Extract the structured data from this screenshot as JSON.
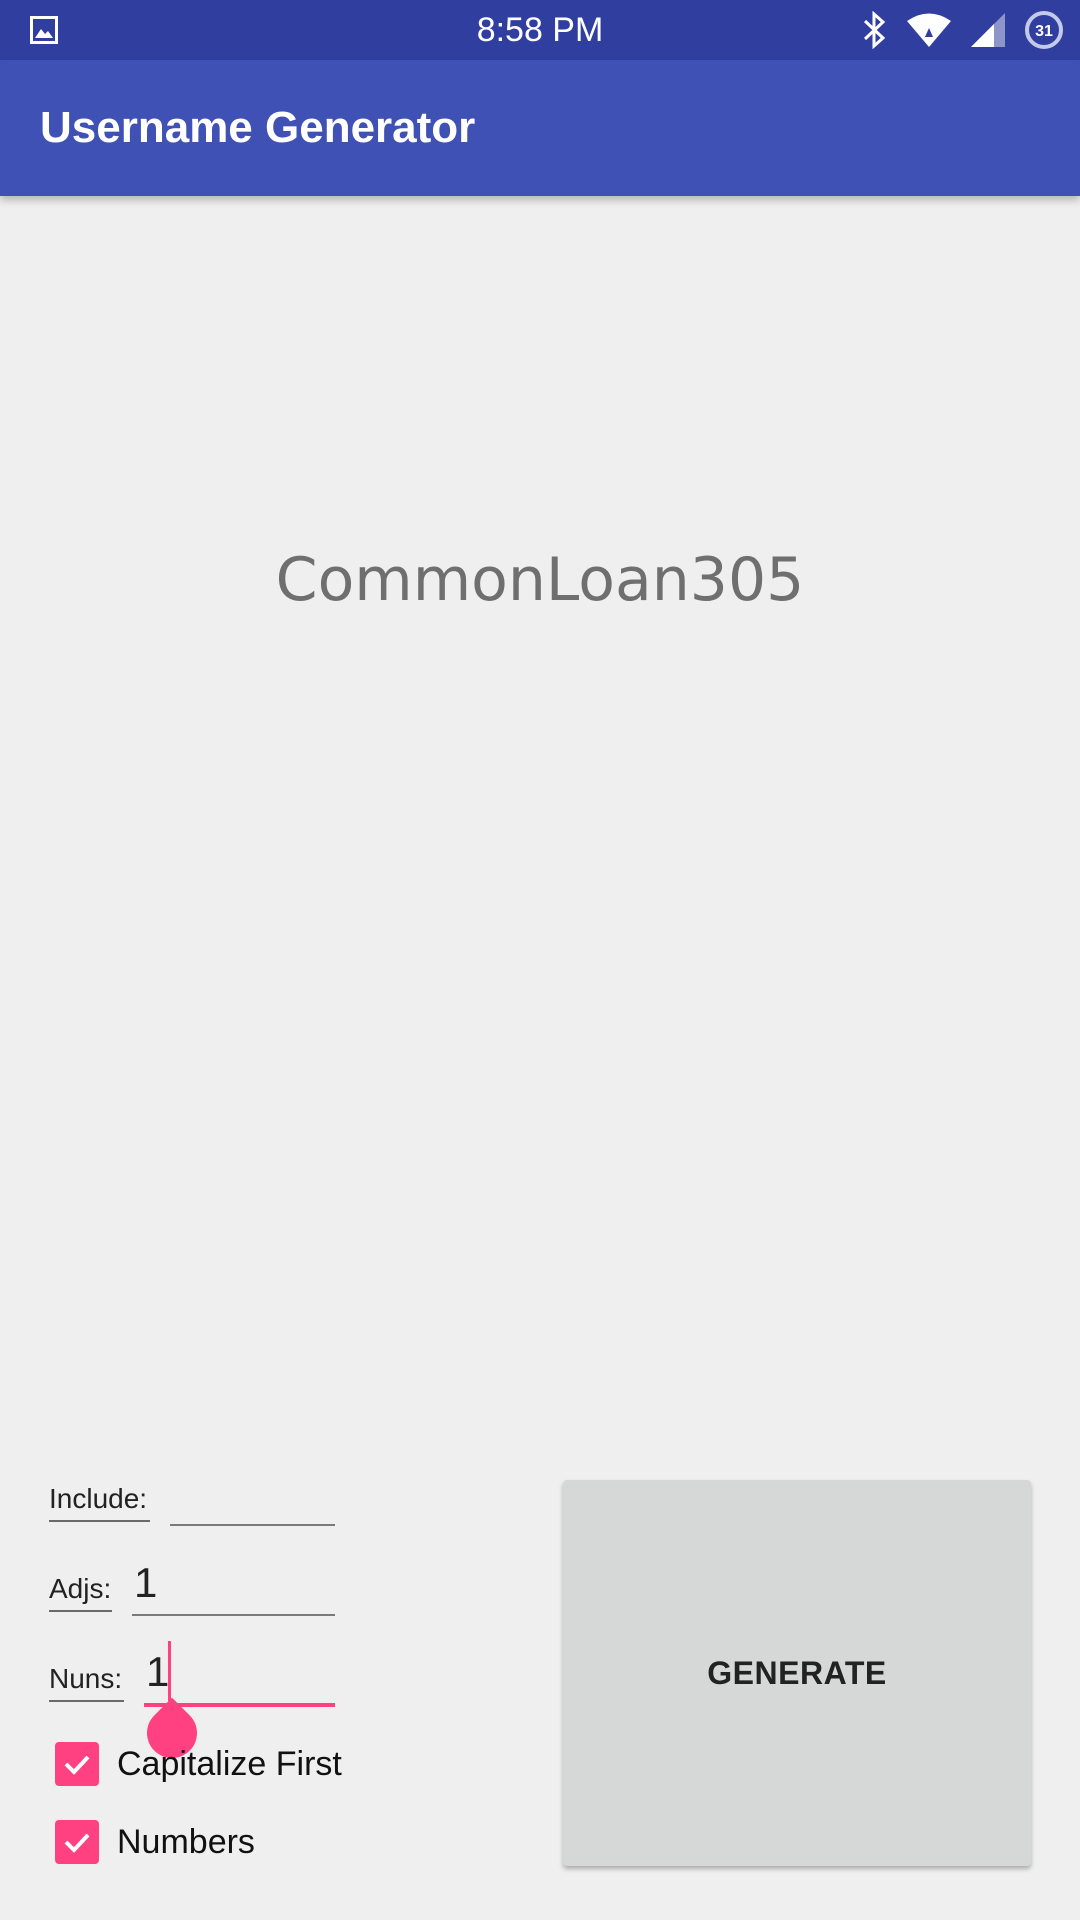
{
  "status_bar": {
    "time": "8:58 PM",
    "calendar_day": "31",
    "left_icon": "gallery-icon",
    "right_icons": [
      "bluetooth-icon",
      "wifi-icon",
      "signal-icon",
      "calendar-icon"
    ]
  },
  "app_bar": {
    "title": "Username Generator"
  },
  "result": {
    "username": "CommonLoan305"
  },
  "form": {
    "include_label": "Include:",
    "include_value": "",
    "adjs_label": "Adjs:",
    "adjs_value": "1",
    "nuns_label": "Nuns:",
    "nuns_value": "1",
    "capitalize_label": "Capitalize First",
    "capitalize_checked": true,
    "numbers_label": "Numbers",
    "numbers_checked": true
  },
  "actions": {
    "generate_label": "GENERATE"
  },
  "colors": {
    "status_bar": "#303f9f",
    "app_bar": "#3f51b5",
    "accent": "#ff4081",
    "background": "#efefef",
    "button": "#d6d7d7"
  }
}
